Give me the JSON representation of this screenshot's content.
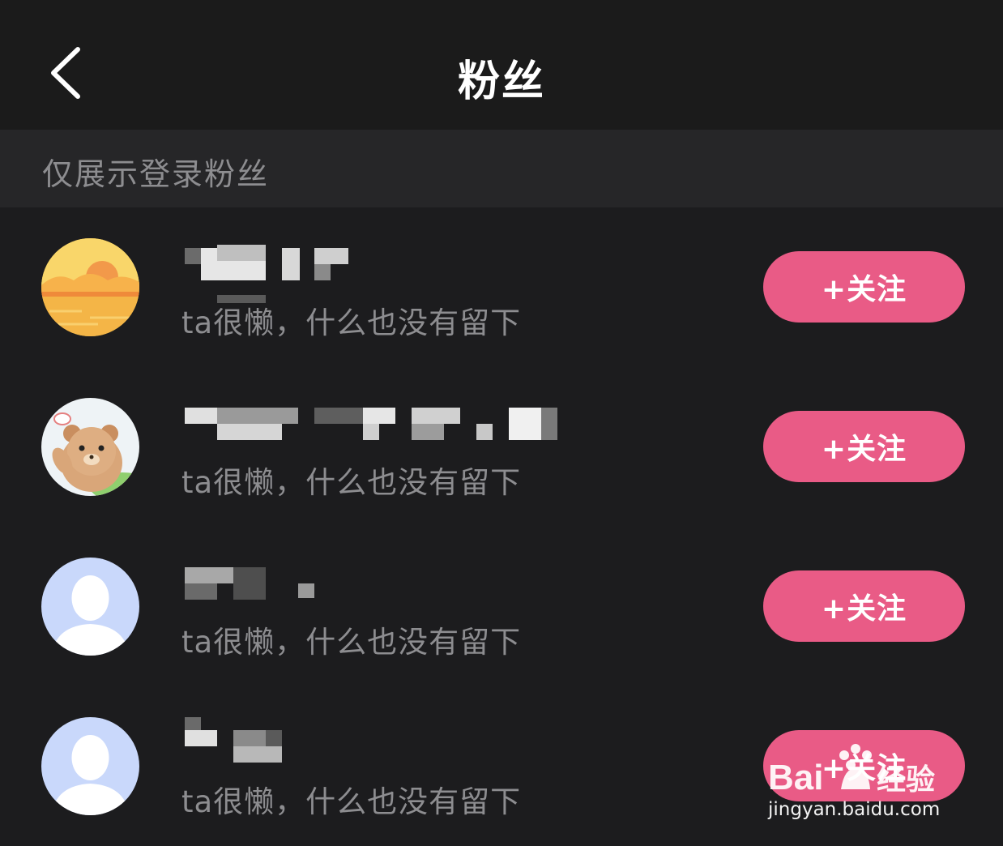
{
  "header": {
    "title": "粉丝"
  },
  "notice": {
    "text": "仅展示登录粉丝"
  },
  "fans": [
    {
      "bio": "ta很懒，什么也没有留下",
      "follow_label": "+关注",
      "avatar": "sunset-avatar"
    },
    {
      "bio": "ta很懒，什么也没有留下",
      "follow_label": "+关注",
      "avatar": "bear-avatar"
    },
    {
      "bio": "ta很懒，什么也没有留下",
      "follow_label": "+关注",
      "avatar": "default-user-avatar"
    },
    {
      "bio": "ta很懒，什么也没有留下",
      "follow_label": "+关注",
      "avatar": "default-user-avatar"
    }
  ],
  "watermark": {
    "brand": "Bai du 经验",
    "url": "jingyan.baidu.com"
  },
  "colors": {
    "accent": "#e95b86",
    "background": "#1c1c1e",
    "notice_bg": "#262628"
  }
}
